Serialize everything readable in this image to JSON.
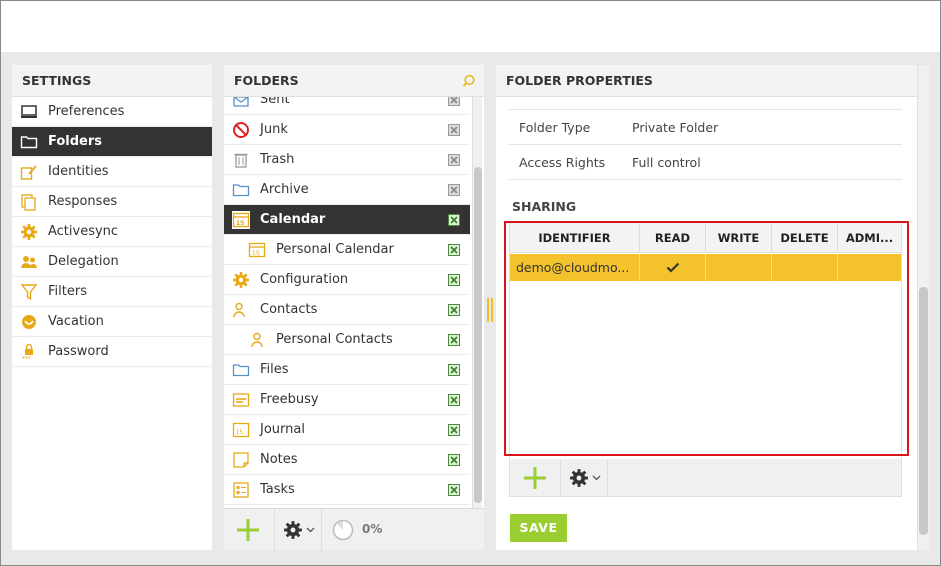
{
  "settings": {
    "title": "SETTINGS",
    "items": [
      {
        "label": "Preferences",
        "icon": "monitor-icon"
      },
      {
        "label": "Folders",
        "icon": "folder-icon",
        "selected": true
      },
      {
        "label": "Identities",
        "icon": "identity-icon"
      },
      {
        "label": "Responses",
        "icon": "responses-icon"
      },
      {
        "label": "Activesync",
        "icon": "gear-icon"
      },
      {
        "label": "Delegation",
        "icon": "users-icon"
      },
      {
        "label": "Filters",
        "icon": "filter-icon"
      },
      {
        "label": "Vacation",
        "icon": "vacation-icon"
      },
      {
        "label": "Password",
        "icon": "password-icon"
      }
    ]
  },
  "folders": {
    "title": "FOLDERS",
    "search_icon": "search-icon",
    "items": [
      {
        "label": "Sent",
        "icon": "sent-icon",
        "subscribed": false
      },
      {
        "label": "Junk",
        "icon": "junk-icon",
        "subscribed": false
      },
      {
        "label": "Trash",
        "icon": "trash-icon",
        "subscribed": false
      },
      {
        "label": "Archive",
        "icon": "archive-folder-icon",
        "subscribed": false
      },
      {
        "label": "Calendar",
        "icon": "calendar-icon",
        "subscribed": true,
        "selected": true
      },
      {
        "label": "Personal Calendar",
        "icon": "calendar-icon",
        "subscribed": true,
        "sub": true
      },
      {
        "label": "Configuration",
        "icon": "gear-icon",
        "subscribed": true
      },
      {
        "label": "Contacts",
        "icon": "contacts-icon",
        "subscribed": true
      },
      {
        "label": "Personal Contacts",
        "icon": "contact-icon",
        "subscribed": true,
        "sub": true
      },
      {
        "label": "Files",
        "icon": "files-folder-icon",
        "subscribed": true
      },
      {
        "label": "Freebusy",
        "icon": "freebusy-icon",
        "subscribed": true
      },
      {
        "label": "Journal",
        "icon": "journal-icon",
        "subscribed": true
      },
      {
        "label": "Notes",
        "icon": "notes-icon",
        "subscribed": true
      },
      {
        "label": "Tasks",
        "icon": "tasks-icon",
        "subscribed": true
      }
    ],
    "quota": "0%"
  },
  "properties": {
    "title": "FOLDER PROPERTIES",
    "rows": [
      {
        "key": "Folder Type",
        "value": "Private Folder"
      },
      {
        "key": "Access Rights",
        "value": "Full control"
      }
    ],
    "sharing_title": "SHARING",
    "columns": [
      "IDENTIFIER",
      "READ",
      "WRITE",
      "DELETE",
      "ADMI..."
    ],
    "entries": [
      {
        "identifier": "demo@cloudmo...",
        "read": true,
        "write": false,
        "delete": false,
        "admin": false
      }
    ],
    "save_label": "SAVE"
  },
  "colors": {
    "accent": "#f4c22b",
    "selected_bg": "#333333",
    "add_green": "#9acd32",
    "highlight_frame": "#d9141b"
  }
}
